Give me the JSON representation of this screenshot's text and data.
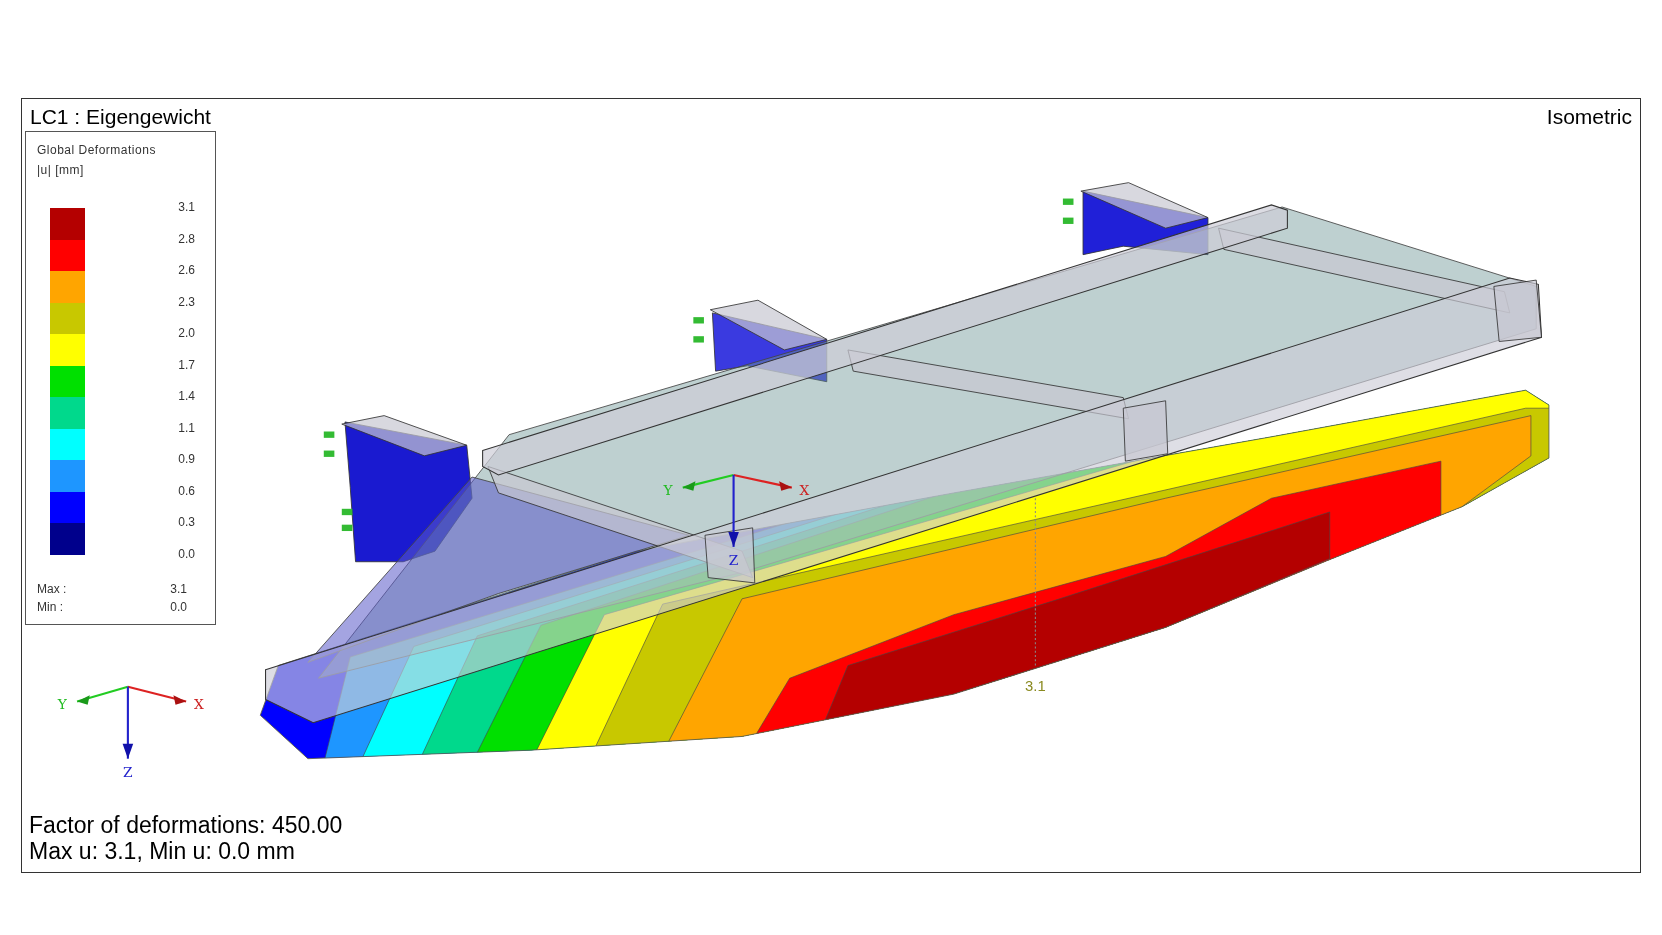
{
  "view": {
    "title": "LC1 : Eigengewicht",
    "projection": "Isometric"
  },
  "legend": {
    "title": "Global Deformations",
    "quantity": "|u| [mm]",
    "bands": [
      {
        "color": "#b40000"
      },
      {
        "color": "#ff0000"
      },
      {
        "color": "#ffa500"
      },
      {
        "color": "#c8c800"
      },
      {
        "color": "#ffff00"
      },
      {
        "color": "#00e000"
      },
      {
        "color": "#00d98c"
      },
      {
        "color": "#00ffff"
      },
      {
        "color": "#1e96ff"
      },
      {
        "color": "#0000ff"
      },
      {
        "color": "#00008c"
      }
    ],
    "values": [
      "3.1",
      "2.8",
      "2.6",
      "2.3",
      "2.0",
      "1.7",
      "1.4",
      "1.1",
      "0.9",
      "0.6",
      "0.3",
      "0.0"
    ],
    "max_label": "Max :",
    "max_value": "3.1",
    "min_label": "Min :",
    "min_value": "0.0"
  },
  "model_axes": {
    "x": "X",
    "y": "Y",
    "z": "Z"
  },
  "orientation_axes": {
    "x": "X",
    "y": "Y",
    "z": "Z"
  },
  "max_marker": "3.1",
  "footer": [
    "Factor of deformations: 450.00",
    "Max u: 3.1, Min u: 0.0 mm"
  ]
}
